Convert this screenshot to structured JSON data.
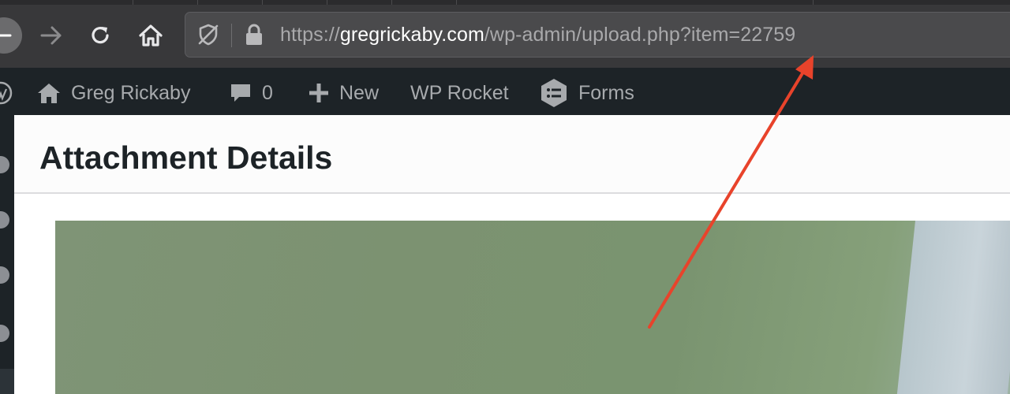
{
  "browser": {
    "url_scheme": "https://",
    "url_host": "gregrickaby.com",
    "url_path": "/wp-admin/upload.php?item=22759",
    "icons": [
      "back-icon",
      "forward-icon",
      "reload-icon",
      "home-icon",
      "tracking-protection-icon",
      "lock-icon"
    ]
  },
  "adminbar": {
    "site_name": "Greg Rickaby",
    "comments_count": "0",
    "new_label": "New",
    "wp_rocket_label": "WP Rocket",
    "forms_label": "Forms"
  },
  "modal": {
    "title": "Attachment Details"
  },
  "annotation": {
    "arrow_color": "#e8432b"
  },
  "colors": {
    "adminbar_bg": "#1d2327",
    "adminbar_text": "#a7aaad",
    "toolbar_bg": "#38383a",
    "urlbar_bg": "#4a4a4c"
  }
}
